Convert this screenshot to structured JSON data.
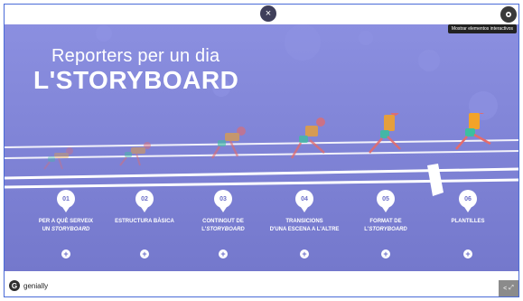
{
  "header": {
    "tooltip": "Mostrar elementos interactivos",
    "close_glyph": "×"
  },
  "title": {
    "line1": "Reporters per un dia",
    "line2": "L'STORYBOARD"
  },
  "steps": [
    {
      "number": "01",
      "line1": "PER A QUÈ SERVEIX",
      "line2a": "UN ",
      "line2b": "STORYBOARD"
    },
    {
      "number": "02",
      "line1": "ESTRUCTURA BÀSICA",
      "line2a": "",
      "line2b": ""
    },
    {
      "number": "03",
      "line1": "CONTINGUT DE",
      "line2a": "L'",
      "line2b": "STORYBOARD"
    },
    {
      "number": "04",
      "line1": "TRANSICIONS",
      "line2a": "D'UNA ESCENA A L'ALTRE",
      "line2b": ""
    },
    {
      "number": "05",
      "line1": "FORMAT DE",
      "line2a": "L'",
      "line2b": "STORYBOARD"
    },
    {
      "number": "06",
      "line1": "PLANTILLES",
      "line2a": "",
      "line2b": ""
    }
  ],
  "plus_glyph": "+",
  "footer": {
    "brand": "genially",
    "logo_glyph": "G",
    "share_glyph": "<",
    "expand_glyph": "⤢"
  },
  "colors": {
    "stage": "#7d81d4",
    "track_line": "#ffffff",
    "runner_shirt": "#f3a328",
    "runner_shorts": "#3cbfa0",
    "runner_skin": "#e46b6b"
  }
}
